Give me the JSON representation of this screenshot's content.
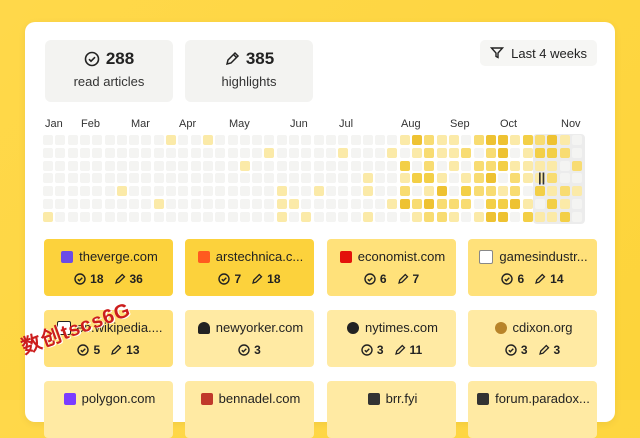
{
  "stats": {
    "read_count": "288",
    "read_label": "read articles",
    "highlight_count": "385",
    "highlight_label": "highlights"
  },
  "filter": {
    "label": "Last 4 weeks",
    "icon": "filter-icon"
  },
  "timeline": {
    "months": [
      "Jan",
      "Feb",
      "Mar",
      "Apr",
      "May",
      "Jun",
      "Jul",
      "Aug",
      "Sep",
      "Oct",
      "Nov"
    ],
    "selection_handle": "||"
  },
  "sites": [
    {
      "name": "theverge.com",
      "reads": "18",
      "highlights": "36",
      "favicon": "#6b4ce6"
    },
    {
      "name": "arstechnica.c...",
      "reads": "7",
      "highlights": "18",
      "favicon": "#ff5a1f"
    },
    {
      "name": "economist.com",
      "reads": "6",
      "highlights": "7",
      "favicon": "#e3120b"
    },
    {
      "name": "gamesindustr...",
      "reads": "6",
      "highlights": "14",
      "favicon": "#888888"
    },
    {
      "name": "en.wikipedia....",
      "reads": "5",
      "highlights": "13",
      "favicon": "#111111"
    },
    {
      "name": "newyorker.com",
      "reads": "3",
      "highlights": "",
      "favicon": "#111111"
    },
    {
      "name": "nytimes.com",
      "reads": "3",
      "highlights": "11",
      "favicon": "#111111"
    },
    {
      "name": "cdixon.org",
      "reads": "3",
      "highlights": "3",
      "favicon": "#b8842a"
    },
    {
      "name": "polygon.com",
      "reads": "",
      "highlights": "",
      "favicon": "#7a3cff"
    },
    {
      "name": "bennadel.com",
      "reads": "",
      "highlights": "",
      "favicon": "#c0392b"
    },
    {
      "name": "brr.fyi",
      "reads": "",
      "highlights": "",
      "favicon": "#333333"
    },
    {
      "name": "forum.paradox...",
      "reads": "",
      "highlights": "",
      "favicon": "#333333"
    }
  ],
  "watermark": "数创tscs6G"
}
